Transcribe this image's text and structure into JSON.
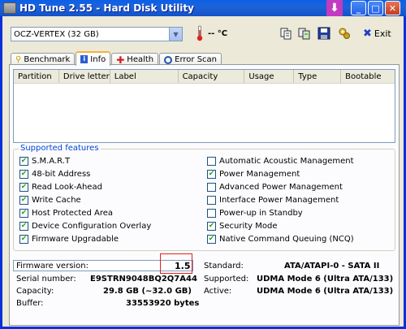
{
  "window": {
    "title": "HD Tune 2.55 - Hard Disk Utility"
  },
  "toolbar": {
    "drive": "OCZ-VERTEX (32 GB)",
    "temperature": "-- °C",
    "exit_label": "Exit"
  },
  "tabs": [
    {
      "label": "Benchmark",
      "icon": "benchmark-icon"
    },
    {
      "label": "Info",
      "icon": "info-icon"
    },
    {
      "label": "Health",
      "icon": "health-icon"
    },
    {
      "label": "Error Scan",
      "icon": "error-scan-icon"
    }
  ],
  "active_tab": "Info",
  "partitions": {
    "columns": [
      "Partition",
      "Drive letter",
      "Label",
      "Capacity",
      "Usage",
      "Type",
      "Bootable"
    ],
    "rows": []
  },
  "features": {
    "title": "Supported features",
    "left": [
      {
        "label": "S.M.A.R.T",
        "checked": true
      },
      {
        "label": "48-bit Address",
        "checked": true
      },
      {
        "label": "Read Look-Ahead",
        "checked": true
      },
      {
        "label": "Write Cache",
        "checked": true
      },
      {
        "label": "Host Protected Area",
        "checked": true
      },
      {
        "label": "Device Configuration Overlay",
        "checked": true
      },
      {
        "label": "Firmware Upgradable",
        "checked": true
      }
    ],
    "right": [
      {
        "label": "Automatic Acoustic Management",
        "checked": false
      },
      {
        "label": "Power Management",
        "checked": true
      },
      {
        "label": "Advanced Power Management",
        "checked": false
      },
      {
        "label": "Interface Power Management",
        "checked": false
      },
      {
        "label": "Power-up in Standby",
        "checked": false
      },
      {
        "label": "Security Mode",
        "checked": true
      },
      {
        "label": "Native Command Queuing (NCQ)",
        "checked": true
      }
    ]
  },
  "info": {
    "firmware_label": "Firmware version:",
    "firmware_value": "1.5",
    "serial_label": "Serial number:",
    "serial_value": "E9STRN9048BQ2Q7A44",
    "capacity_label": "Capacity:",
    "capacity_value": "29.8 GB (~32.0 GB)",
    "buffer_label": "Buffer:",
    "buffer_value": "33553920 bytes",
    "standard_label": "Standard:",
    "standard_value": "ATA/ATAPI-0 - SATA II",
    "supported_label": "Supported:",
    "supported_value": "UDMA Mode 6 (Ultra ATA/133)",
    "active_label": "Active:",
    "active_value": "UDMA Mode 6 (Ultra ATA/133)"
  }
}
